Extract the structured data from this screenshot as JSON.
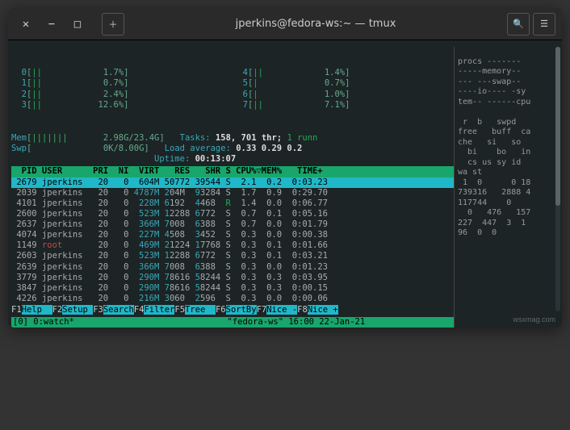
{
  "titlebar": {
    "close": "✕",
    "min": "−",
    "max": "□",
    "newtab": "＋",
    "title": "jperkins@fedora-ws:~ — tmux",
    "search": "🔍",
    "menu": "☰"
  },
  "cpu_meters": [
    {
      "id": "0",
      "bar": "||",
      "val": "1.7%"
    },
    {
      "id": "1",
      "bar": "||",
      "val": "0.7%"
    },
    {
      "id": "2",
      "bar": "||",
      "val": "2.4%"
    },
    {
      "id": "3",
      "bar": "||",
      "val": "12.6%"
    },
    {
      "id": "4",
      "bar": "||",
      "val": "1.4%"
    },
    {
      "id": "5",
      "bar": "|",
      "val": "0.7%"
    },
    {
      "id": "6",
      "bar": "|",
      "val": "1.0%"
    },
    {
      "id": "7",
      "bar": "||",
      "val": "7.1%"
    }
  ],
  "mem": {
    "label": "Mem",
    "bar": "|||||||",
    "val": "2.98G/23.4G"
  },
  "swp": {
    "label": "Swp",
    "bar": "",
    "val": "0K/8.00G"
  },
  "sysinfo": {
    "tasks_label": "Tasks:",
    "tasks": "158,",
    "thr": "701 thr;",
    "run": "1 runn",
    "load_label": "Load average:",
    "load": "0.33 0.29 0.2",
    "uptime_label": "Uptime:",
    "uptime": "00:13:07"
  },
  "headers": "  PID USER      PRI  NI  VIRT   RES   SHR S CPU%▽MEM%   TIME+ ",
  "processes": [
    {
      "sel": true,
      "pid": "2679",
      "user": "jperkins",
      "pri": "20",
      "ni": "0",
      "virt": "604M",
      "res": "50772",
      "shr": "39544",
      "s": "S",
      "cpu": "2.1",
      "mem": "0.2",
      "time": "0:03.23"
    },
    {
      "pid": "2039",
      "user": "jperkins",
      "pri": "20",
      "ni": "0",
      "virt": "4787M",
      "res": "204M",
      "shr": "93284",
      "s": "S",
      "cpu": "1.7",
      "mem": "0.9",
      "time": "0:29.70"
    },
    {
      "pid": "4101",
      "user": "jperkins",
      "pri": "20",
      "ni": "0",
      "virt": "228M",
      "res": "6192",
      "shr": "4468",
      "s": "R",
      "cpu": "1.4",
      "mem": "0.0",
      "time": "0:06.77"
    },
    {
      "pid": "2600",
      "user": "jperkins",
      "pri": "20",
      "ni": "0",
      "virt": "523M",
      "res": "12288",
      "shr": "6772",
      "s": "S",
      "cpu": "0.7",
      "mem": "0.1",
      "time": "0:05.16"
    },
    {
      "pid": "2637",
      "user": "jperkins",
      "pri": "20",
      "ni": "0",
      "virt": "366M",
      "res": "7008",
      "shr": "6388",
      "s": "S",
      "cpu": "0.7",
      "mem": "0.0",
      "time": "0:01.79"
    },
    {
      "pid": "4074",
      "user": "jperkins",
      "pri": "20",
      "ni": "0",
      "virt": "227M",
      "res": "4508",
      "shr": "3452",
      "s": "S",
      "cpu": "0.3",
      "mem": "0.0",
      "time": "0:00.38"
    },
    {
      "pid": "1149",
      "user": "root",
      "pri": "20",
      "ni": "0",
      "virt": "469M",
      "res": "21224",
      "shr": "17768",
      "s": "S",
      "cpu": "0.3",
      "mem": "0.1",
      "time": "0:01.66"
    },
    {
      "pid": "2603",
      "user": "jperkins",
      "pri": "20",
      "ni": "0",
      "virt": "523M",
      "res": "12288",
      "shr": "6772",
      "s": "S",
      "cpu": "0.3",
      "mem": "0.1",
      "time": "0:03.21"
    },
    {
      "pid": "2639",
      "user": "jperkins",
      "pri": "20",
      "ni": "0",
      "virt": "366M",
      "res": "7008",
      "shr": "6388",
      "s": "S",
      "cpu": "0.3",
      "mem": "0.0",
      "time": "0:01.23"
    },
    {
      "pid": "3779",
      "user": "jperkins",
      "pri": "20",
      "ni": "0",
      "virt": "290M",
      "res": "78616",
      "shr": "58244",
      "s": "S",
      "cpu": "0.3",
      "mem": "0.3",
      "time": "0:03.95"
    },
    {
      "pid": "3847",
      "user": "jperkins",
      "pri": "20",
      "ni": "0",
      "virt": "290M",
      "res": "78616",
      "shr": "58244",
      "s": "S",
      "cpu": "0.3",
      "mem": "0.3",
      "time": "0:00.15"
    },
    {
      "pid": "4226",
      "user": "jperkins",
      "pri": "20",
      "ni": "0",
      "virt": "216M",
      "res": "3060",
      "shr": "2596",
      "s": "S",
      "cpu": "0.3",
      "mem": "0.0",
      "time": "0:00.06"
    }
  ],
  "fnkeys": [
    {
      "k": "F1",
      "l": "Help  "
    },
    {
      "k": "F2",
      "l": "Setup "
    },
    {
      "k": "F3",
      "l": "Search"
    },
    {
      "k": "F4",
      "l": "Filter"
    },
    {
      "k": "F5",
      "l": "Tree  "
    },
    {
      "k": "F6",
      "l": "SortBy"
    },
    {
      "k": "F7",
      "l": "Nice -"
    },
    {
      "k": "F8",
      "l": "Nice +"
    }
  ],
  "status": {
    "left": "[0] 0:watch*",
    "right": "\"fedora-ws\" 16:00 22-Jan-21"
  },
  "side_lines": [
    "",
    "procs -------",
    "-----memory--",
    "--- ---swap--",
    "----io---- -sy",
    "tem-- ------cpu",
    "",
    " r  b   swpd",
    "free   buff  ca",
    "che   si   so",
    "  bi    bo   in",
    "  cs us sy id",
    "wa st",
    " 1  0      0 18",
    "739316   2888 4",
    "117744    0",
    "  0   476   157",
    "227  447  3  1",
    "96  0  0"
  ],
  "watermark": "wsxmag.com"
}
